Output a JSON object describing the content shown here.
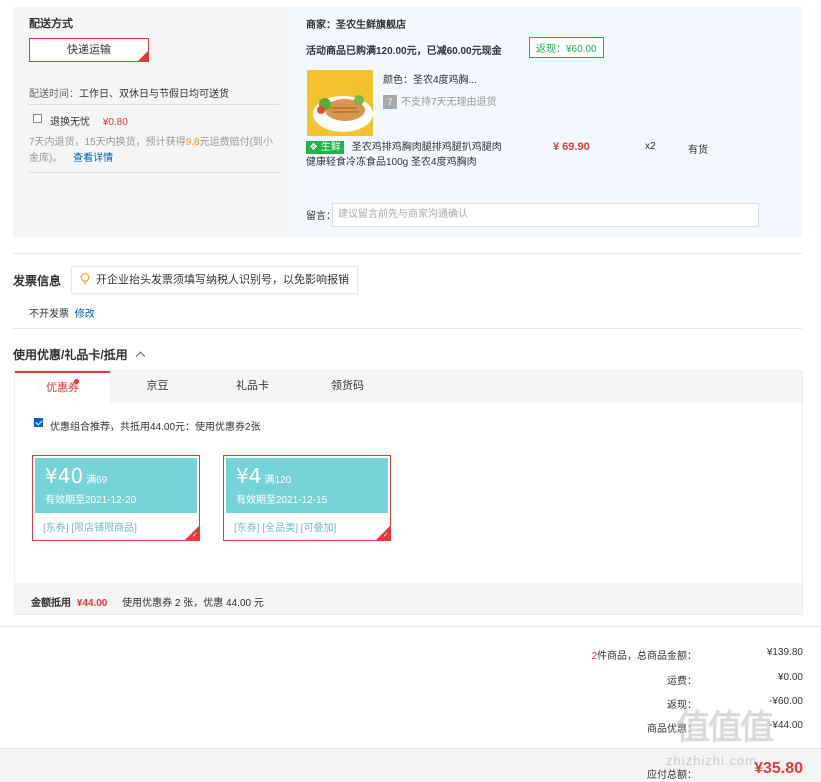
{
  "shipping": {
    "title": "配送方式",
    "method_button": "快递运输",
    "delivery_time_label": "配送时间：",
    "delivery_time_value": "工作日、双休日与节假日均可送货",
    "insurance_label": "退换无忧",
    "insurance_price": "¥0.80",
    "insurance_desc_1": "7天内退货，15天内换货，预计获得",
    "insurance_desc_highlight": "9.8",
    "insurance_desc_2": "元运费赔付(到小",
    "insurance_desc_3": "金库)。",
    "insurance_link": "查看详情"
  },
  "shop": {
    "merchant_label": "商家：",
    "merchant_name": "圣农生鲜旗舰店",
    "promo_text": "活动商品已购满120.00元，已减60.00元现金",
    "rebate_tag": "返现：¥60.00",
    "color_label": "颜色：圣农4度鸡胸...",
    "no_return_badge": "7",
    "no_return_text": "不支持7天无理由退货",
    "fresh_tag": "生鲜",
    "product_title_1": "圣农鸡排鸡胸肉腿排鸡腿扒鸡腿肉",
    "product_title_2": "健康轻食冷冻食品100g 圣农4度鸡胸肉",
    "price": "¥ 69.90",
    "quantity": "x2",
    "stock": "有货",
    "note_label": "留言：",
    "note_placeholder": "建议留言前先与商家沟通确认"
  },
  "invoice": {
    "title": "发票信息",
    "tip": "开企业抬头发票须填写纳税人识别号，以免影响报销",
    "value": "不开发票",
    "edit_link": "修改"
  },
  "coupons": {
    "title": "使用优惠/礼品卡/抵用",
    "tabs": [
      "优惠券",
      "京豆",
      "礼品卡",
      "领货码"
    ],
    "recommend_text": "优惠组合推荐，共抵用44.00元：使用优惠券2张",
    "items": [
      {
        "amount": "¥40",
        "condition": "满69",
        "expiry": "有效期至2021-12-20",
        "tags": "[东券]  [限店铺限商品]"
      },
      {
        "amount": "¥4",
        "condition": "满120",
        "expiry": "有效期至2021-12-15",
        "tags": "[东券]  [全品类]  [可叠加]"
      }
    ],
    "deduct_label": "金额抵用",
    "deduct_value": "¥44.00",
    "deduct_desc": "使用优惠券 2 张，优惠 44.00 元"
  },
  "summary": {
    "count": "2",
    "count_label": "件商品，总商品金额：",
    "total": "¥139.80",
    "shipping_label": "运费：",
    "shipping_value": "¥0.00",
    "rebate_label": "返现：",
    "rebate_value": "-¥60.00",
    "discount_label": "商品优惠：",
    "discount_value": "-¥44.00",
    "payable_label": "应付总额：",
    "payable_value": "¥35.80"
  },
  "watermark": {
    "logo": "值值值",
    "site": "zhizhizhi.com"
  },
  "colors": {
    "accent": "#e4393c",
    "link": "#005ea7",
    "coupon": "#77d4d6",
    "fresh": "#22b14c"
  }
}
